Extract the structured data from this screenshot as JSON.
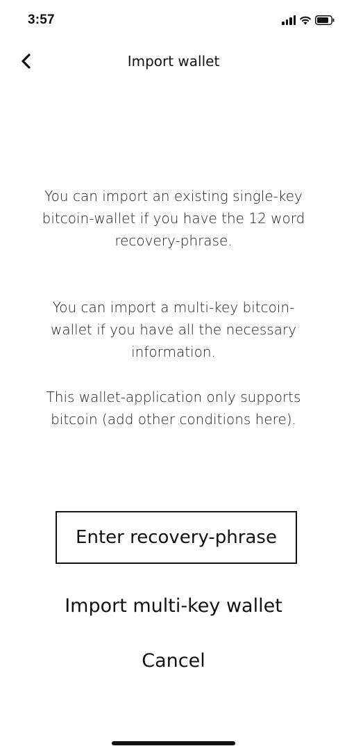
{
  "status_bar": {
    "time": "3:57",
    "icons": [
      "signal-icon",
      "wifi-icon",
      "battery-icon"
    ]
  },
  "nav": {
    "back_icon": "chevron-left-icon",
    "title": "Import wallet"
  },
  "content": {
    "paragraph_1": "You can import an existing single-key bitcoin-wallet if you have the 12 word recovery-phrase.",
    "paragraph_2": "You can import a multi-key bitcoin-wallet if you have all the necessary information.",
    "paragraph_3": "This wallet-application only supports bitcoin (add other conditions here)."
  },
  "actions": {
    "enter_recovery_phrase": "Enter recovery-phrase",
    "import_multi_key": "Import multi-key wallet",
    "cancel": "Cancel"
  }
}
